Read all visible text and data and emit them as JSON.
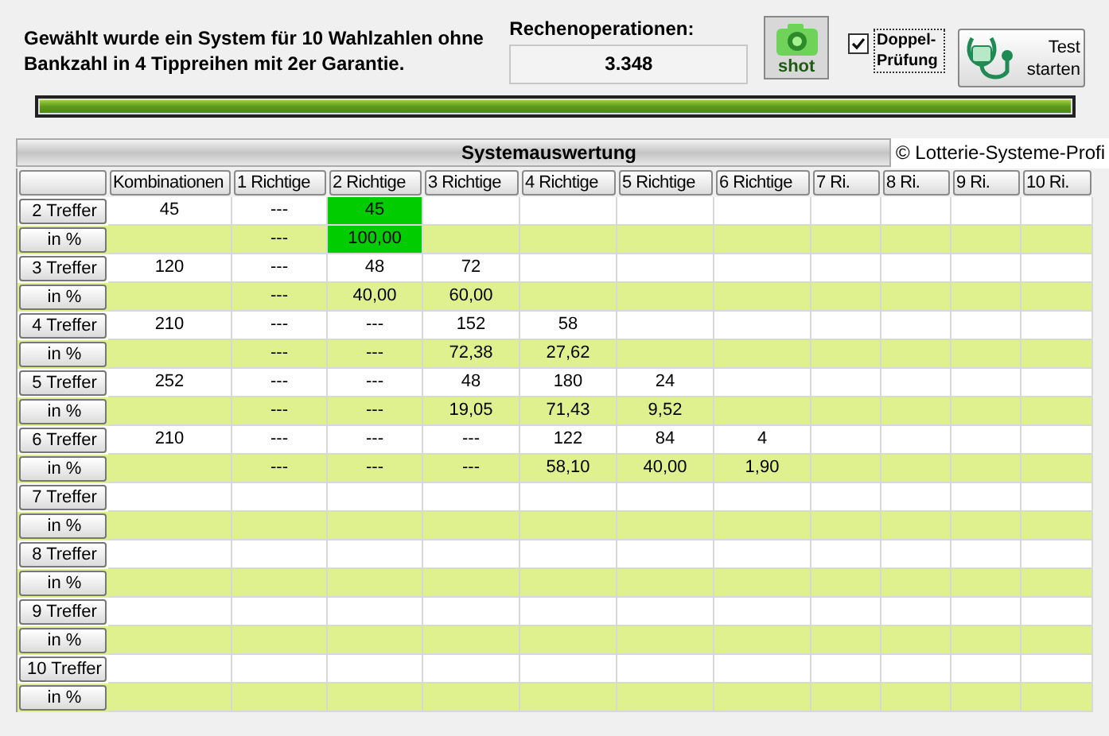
{
  "summary": {
    "text": "Gewählt wurde ein System für 10 Wahlzahlen ohne Bankzahl in 4 Tippreihen mit 2er Garantie.",
    "operations_label": "Rechenoperationen:",
    "operations_value": "3.348"
  },
  "shot_button": {
    "label": "shot"
  },
  "double_check": {
    "label": "Doppel-Prüfung",
    "checked": true
  },
  "test_button": {
    "label": "Test starten"
  },
  "progress": {
    "level": 1
  },
  "evaluation": {
    "title": "Systemauswertung",
    "copyright": "© Lotterie-Systeme-Profi",
    "columns": [
      "Kombinationen",
      "1 Richtige",
      "2 Richtige",
      "3 Richtige",
      "4 Richtige",
      "5 Richtige",
      "6 Richtige",
      "7 Ri.",
      "8 Ri.",
      "9 Ri.",
      "10 Ri."
    ],
    "rows": [
      {
        "label": "2 Treffer",
        "kind": "count",
        "cells": [
          {
            "text": "45",
            "highlighted": false
          },
          {
            "text": "---",
            "highlighted": false
          },
          {
            "text": "45",
            "highlighted": true
          }
        ]
      },
      {
        "label": "in %",
        "kind": "percent",
        "cells": [
          {
            "highlighted": false
          },
          {
            "text": "---",
            "highlighted": false
          },
          {
            "text": "100,00",
            "highlighted": true
          }
        ]
      },
      {
        "label": "3 Treffer",
        "kind": "count",
        "cells": [
          {
            "text": "120",
            "highlighted": false
          },
          {
            "text": "---",
            "highlighted": false
          },
          {
            "text": "48",
            "highlighted": false
          },
          {
            "text": "72",
            "highlighted": false
          }
        ]
      },
      {
        "label": "in %",
        "kind": "percent",
        "cells": [
          {
            "highlighted": false
          },
          {
            "text": "---",
            "highlighted": false
          },
          {
            "text": "40,00",
            "highlighted": false
          },
          {
            "text": "60,00",
            "highlighted": false
          }
        ]
      },
      {
        "label": "4 Treffer",
        "kind": "count",
        "cells": [
          {
            "text": "210",
            "highlighted": false
          },
          {
            "text": "---",
            "highlighted": false
          },
          {
            "text": "---",
            "highlighted": false
          },
          {
            "text": "152",
            "highlighted": false
          },
          {
            "text": "58",
            "highlighted": false
          }
        ]
      },
      {
        "label": "in %",
        "kind": "percent",
        "cells": [
          {
            "highlighted": false
          },
          {
            "text": "---",
            "highlighted": false
          },
          {
            "text": "---",
            "highlighted": false
          },
          {
            "text": "72,38",
            "highlighted": false
          },
          {
            "text": "27,62",
            "highlighted": false
          }
        ]
      },
      {
        "label": "5 Treffer",
        "kind": "count",
        "cells": [
          {
            "text": "252",
            "highlighted": false
          },
          {
            "text": "---",
            "highlighted": false
          },
          {
            "text": "---",
            "highlighted": false
          },
          {
            "text": "48",
            "highlighted": false
          },
          {
            "text": "180",
            "highlighted": false
          },
          {
            "text": "24",
            "highlighted": false
          }
        ]
      },
      {
        "label": "in %",
        "kind": "percent",
        "cells": [
          {
            "highlighted": false
          },
          {
            "text": "---",
            "highlighted": false
          },
          {
            "text": "---",
            "highlighted": false
          },
          {
            "text": "19,05",
            "highlighted": false
          },
          {
            "text": "71,43",
            "highlighted": false
          },
          {
            "text": "9,52",
            "highlighted": false
          }
        ]
      },
      {
        "label": "6 Treffer",
        "kind": "count",
        "cells": [
          {
            "text": "210",
            "highlighted": false
          },
          {
            "text": "---",
            "highlighted": false
          },
          {
            "text": "---",
            "highlighted": false
          },
          {
            "text": "---",
            "highlighted": false
          },
          {
            "text": "122",
            "highlighted": false
          },
          {
            "text": "84",
            "highlighted": false
          },
          {
            "text": "4",
            "highlighted": false
          }
        ]
      },
      {
        "label": "in %",
        "kind": "percent",
        "cells": [
          {
            "highlighted": false
          },
          {
            "text": "---",
            "highlighted": false
          },
          {
            "text": "---",
            "highlighted": false
          },
          {
            "text": "---",
            "highlighted": false
          },
          {
            "text": "58,10",
            "highlighted": false
          },
          {
            "text": "40,00",
            "highlighted": false
          },
          {
            "text": "1,90",
            "highlighted": false
          }
        ]
      },
      {
        "label": "7 Treffer",
        "kind": "count",
        "cells": []
      },
      {
        "label": "in %",
        "kind": "percent",
        "cells": []
      },
      {
        "label": "8 Treffer",
        "kind": "count",
        "cells": []
      },
      {
        "label": "in %",
        "kind": "percent",
        "cells": []
      },
      {
        "label": "9 Treffer",
        "kind": "count",
        "cells": []
      },
      {
        "label": "in %",
        "kind": "percent",
        "cells": []
      },
      {
        "label": "10 Treffer",
        "kind": "count",
        "cells": []
      },
      {
        "label": "in %",
        "kind": "percent",
        "cells": []
      }
    ]
  }
}
